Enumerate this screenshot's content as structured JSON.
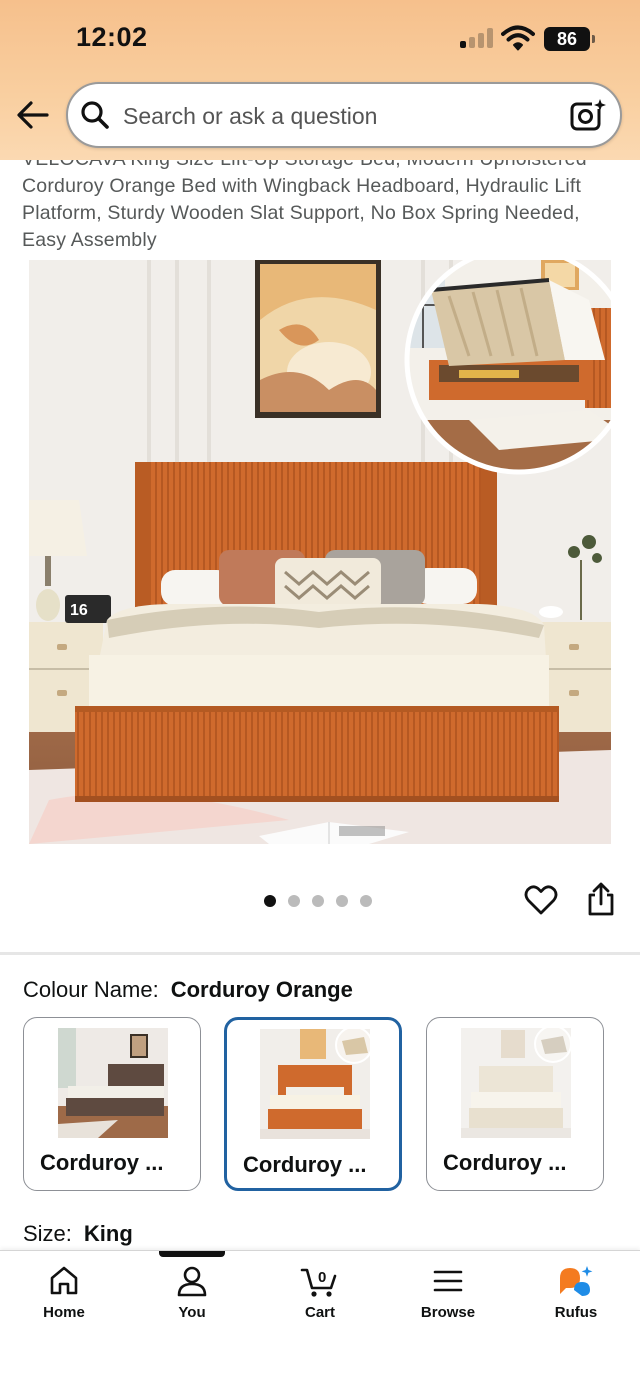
{
  "status_bar": {
    "time": "12:02",
    "battery": "86"
  },
  "search": {
    "placeholder": "Search or ask a question"
  },
  "product": {
    "title": "VELOCAVA King Size Lift-Up Storage Bed, Modern Upholstered Corduroy Orange Bed with Wingback Headboard, Hydraulic Lift Platform, Sturdy Wooden Slat Support, No Box Spring Needed, Easy Assembly",
    "image_count": 5,
    "active_image_index": 0,
    "clock_display": "16"
  },
  "colour": {
    "label": "Colour Name:",
    "value": "Corduroy Orange",
    "options": [
      {
        "label": "Corduroy ...",
        "selected": false,
        "color": "#5e4a40"
      },
      {
        "label": "Corduroy ...",
        "selected": true,
        "color": "#d06a2e"
      },
      {
        "label": "Corduroy ...",
        "selected": false,
        "color": "#ece5d6"
      }
    ]
  },
  "size": {
    "label": "Size:",
    "value": "King"
  },
  "bottom_nav": {
    "items": [
      {
        "label": "Home",
        "icon": "home-icon"
      },
      {
        "label": "You",
        "icon": "person-icon"
      },
      {
        "label": "Cart",
        "icon": "cart-icon",
        "badge": "0"
      },
      {
        "label": "Browse",
        "icon": "menu-icon"
      },
      {
        "label": "Rufus",
        "icon": "rufus-icon"
      }
    ],
    "active_index": 1
  },
  "colors": {
    "header_top": "#f6c08c",
    "selected_border": "#2162a1",
    "bed_orange": "#d06a2e",
    "rufus_orange": "#f47b20",
    "rufus_blue": "#1f8ce6"
  }
}
